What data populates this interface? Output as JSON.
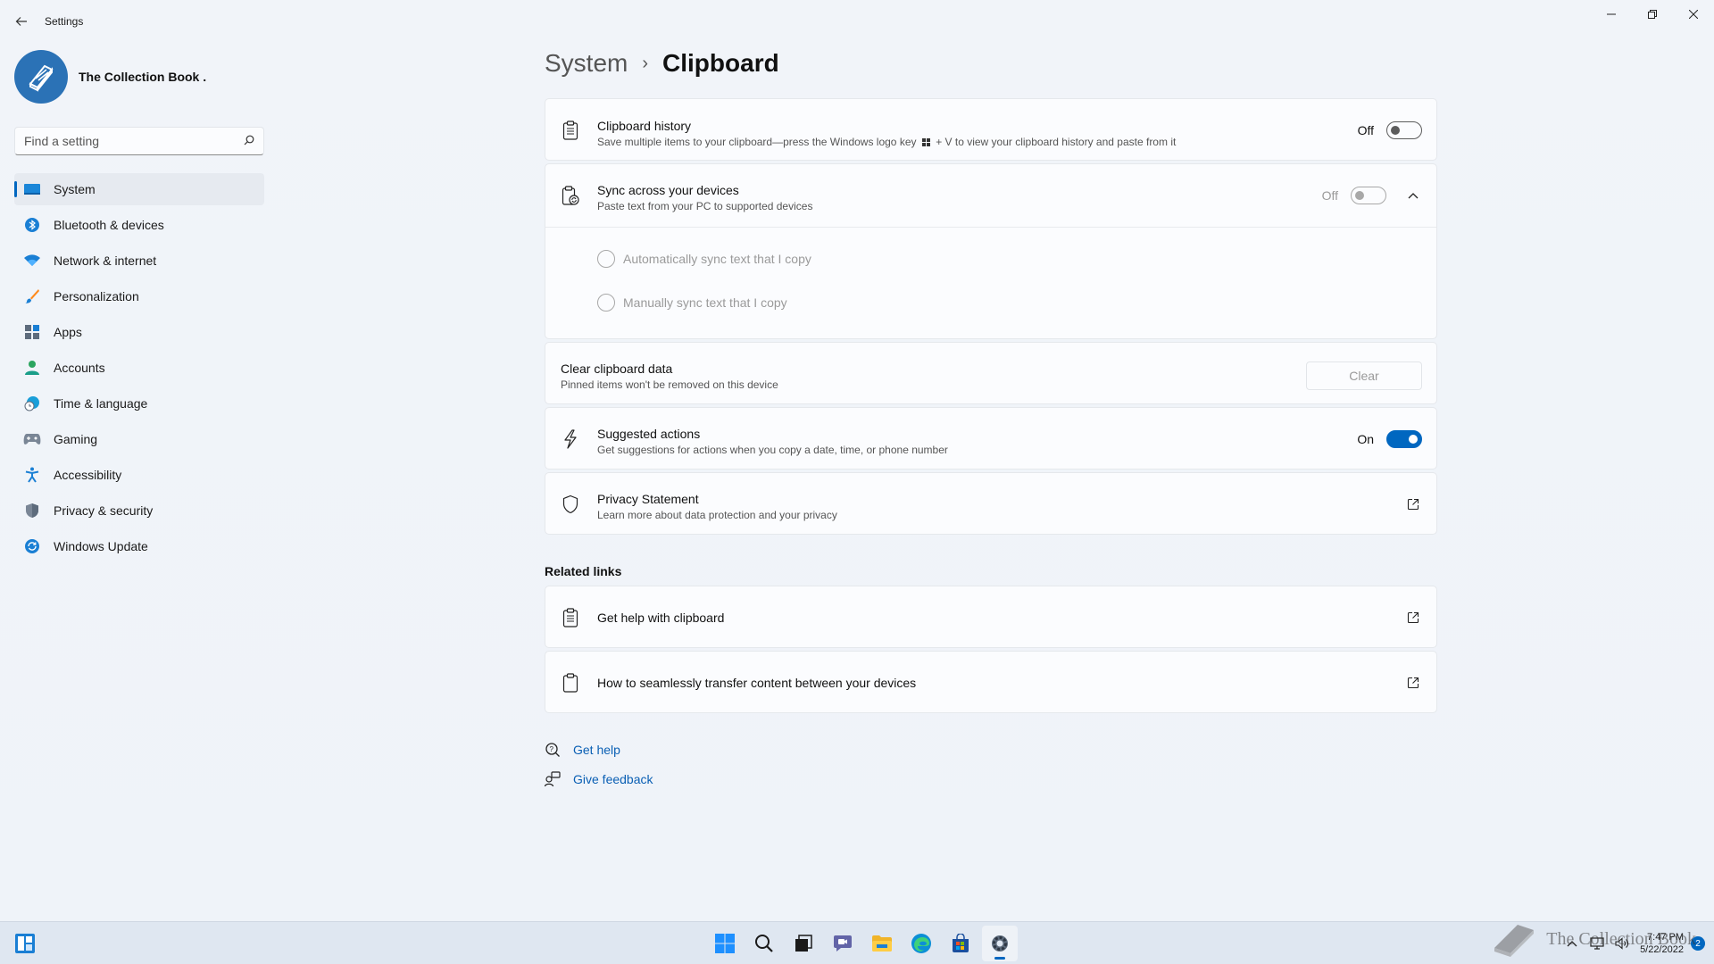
{
  "window": {
    "app_title": "Settings"
  },
  "profile": {
    "name": "The Collection Book ."
  },
  "search": {
    "placeholder": "Find a setting"
  },
  "sidebar": {
    "items": [
      {
        "label": "System",
        "icon": "system-icon",
        "active": true
      },
      {
        "label": "Bluetooth & devices",
        "icon": "bluetooth-icon"
      },
      {
        "label": "Network & internet",
        "icon": "wifi-icon"
      },
      {
        "label": "Personalization",
        "icon": "brush-icon"
      },
      {
        "label": "Apps",
        "icon": "apps-icon"
      },
      {
        "label": "Accounts",
        "icon": "accounts-icon"
      },
      {
        "label": "Time & language",
        "icon": "globe-clock-icon"
      },
      {
        "label": "Gaming",
        "icon": "gamepad-icon"
      },
      {
        "label": "Accessibility",
        "icon": "accessibility-icon"
      },
      {
        "label": "Privacy & security",
        "icon": "shield-icon"
      },
      {
        "label": "Windows Update",
        "icon": "update-icon"
      }
    ]
  },
  "breadcrumb": {
    "parent": "System",
    "separator": "›",
    "current": "Clipboard"
  },
  "settings": {
    "clipboard_history": {
      "title": "Clipboard history",
      "subtitle_before": "Save multiple items to your clipboard—press the Windows logo key",
      "subtitle_after": "+ V to view your clipboard history and paste from it",
      "state_label": "Off",
      "on": false
    },
    "sync": {
      "title": "Sync across your devices",
      "subtitle": "Paste text from your PC to supported devices",
      "state_label": "Off",
      "on": false,
      "options": [
        "Automatically sync text that I copy",
        "Manually sync text that I copy"
      ]
    },
    "clear": {
      "title": "Clear clipboard data",
      "subtitle": "Pinned items won't be removed on this device",
      "button_label": "Clear"
    },
    "suggested": {
      "title": "Suggested actions",
      "subtitle": "Get suggestions for actions when you copy a date, time, or phone number",
      "state_label": "On",
      "on": true
    },
    "privacy": {
      "title": "Privacy Statement",
      "subtitle": "Learn more about data protection and your privacy"
    }
  },
  "related_links": {
    "title": "Related links",
    "items": [
      "Get help with clipboard",
      "How to seamlessly transfer content between your devices"
    ]
  },
  "help": {
    "get_help": "Get help",
    "feedback": "Give feedback"
  },
  "taskbar": {
    "time": "7:47 PM",
    "date": "5/22/2022",
    "notification_count": "2",
    "watermark": "The Collection Book"
  },
  "colors": {
    "accent": "#0067c0",
    "link": "#0a5fb4"
  }
}
